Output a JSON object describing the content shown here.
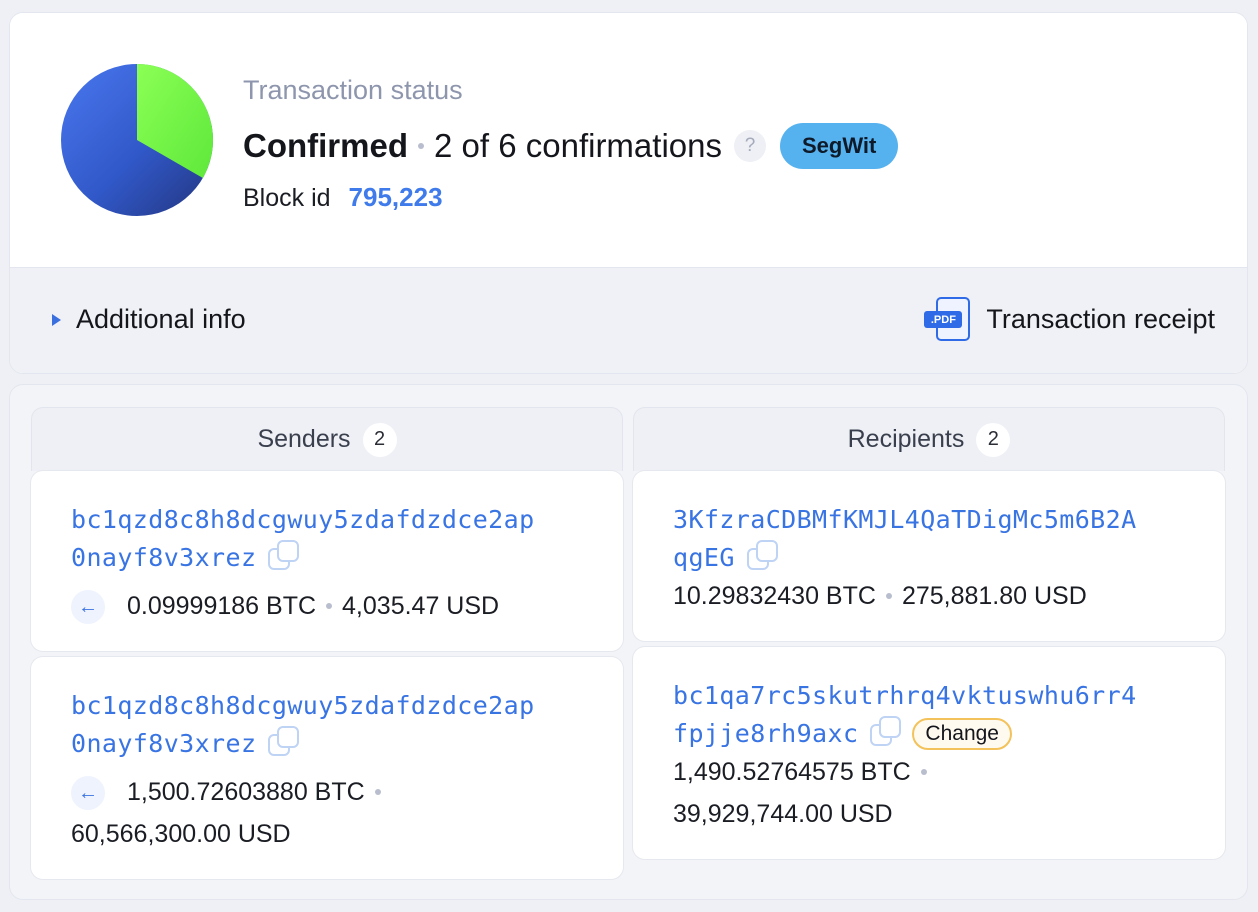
{
  "status": {
    "label": "Transaction status",
    "state": "Confirmed",
    "confirmations_text": "2 of 6 confirmations",
    "help_symbol": "?",
    "badge": "SegWit",
    "block_label": "Block id",
    "block_id": "795,223",
    "confirmations": 2,
    "required_confirmations": 6
  },
  "links": {
    "additional_info": "Additional info",
    "receipt": "Transaction receipt",
    "pdf_tag": ".PDF"
  },
  "senders": {
    "title": "Senders",
    "count": "2",
    "items": [
      {
        "address_line1": "bc1qzd8c8h8dcgwuy5zdafdzdce2ap",
        "address_line2": "0nayf8v3xrez",
        "btc": "0.09999186 BTC",
        "usd": "4,035.47 USD"
      },
      {
        "address_line1": "bc1qzd8c8h8dcgwuy5zdafdzdce2ap",
        "address_line2": "0nayf8v3xrez",
        "btc": "1,500.72603880 BTC",
        "usd": "60,566,300.00 USD"
      }
    ]
  },
  "recipients": {
    "title": "Recipients",
    "count": "2",
    "items": [
      {
        "address_line1": "3KfzraCDBMfKMJL4QaTDigMc5m6B2A",
        "address_line2": "qgEG",
        "btc": "10.29832430 BTC",
        "usd": "275,881.80 USD"
      },
      {
        "address_line1": "bc1qa7rc5skutrhrq4vktuswhu6rr4",
        "address_line2": "fpjje8rh9axc",
        "badge": "Change",
        "btc": "1,490.52764575 BTC",
        "usd": "39,929,744.00 USD"
      }
    ]
  },
  "icons": {
    "progress": "pie-progress-icon",
    "expand": "triangle-right-icon",
    "receipt": "pdf-file-icon",
    "copy": "copy-icon",
    "incoming": "arrow-left-icon"
  },
  "colors": {
    "accent": "#3f7bea",
    "segwit": "#56b2ef",
    "pie_done": "#7dfc4a",
    "pie_pending": "#3a66dc",
    "change_border": "#f3c25a"
  }
}
